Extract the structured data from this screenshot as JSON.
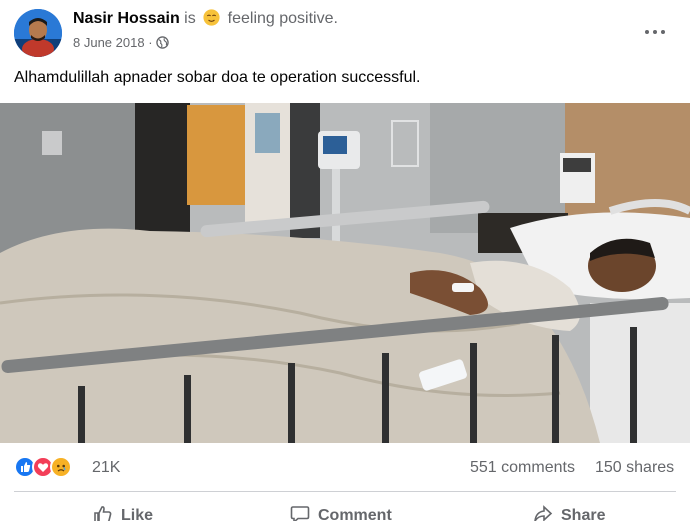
{
  "post": {
    "author": "Nasir Hossain",
    "is_word": "is",
    "feeling": "feeling positive.",
    "date": "8 June 2018",
    "separator": "·",
    "text": "Alhamdulillah apnader sobar doa te operation successful."
  },
  "icons": {
    "avatar": "profile-photo",
    "feeling": "relieved-face-emoji",
    "audience": "globe-icon",
    "more": "more-options-icon",
    "reactions": [
      "like-reaction-icon",
      "love-reaction-icon",
      "sad-reaction-icon"
    ],
    "like": "thumbs-up-icon",
    "comment": "speech-bubble-icon",
    "share": "share-arrow-icon"
  },
  "stats": {
    "reactions": "21K",
    "comments": "551 comments",
    "shares": "150 shares"
  },
  "actions": {
    "like": "Like",
    "comment": "Comment",
    "share": "Share"
  },
  "colors": {
    "like_blue": "#1877f2",
    "love_red": "#f33e58",
    "sad_yellow": "#f7b125",
    "secondary_text": "#65676b"
  }
}
